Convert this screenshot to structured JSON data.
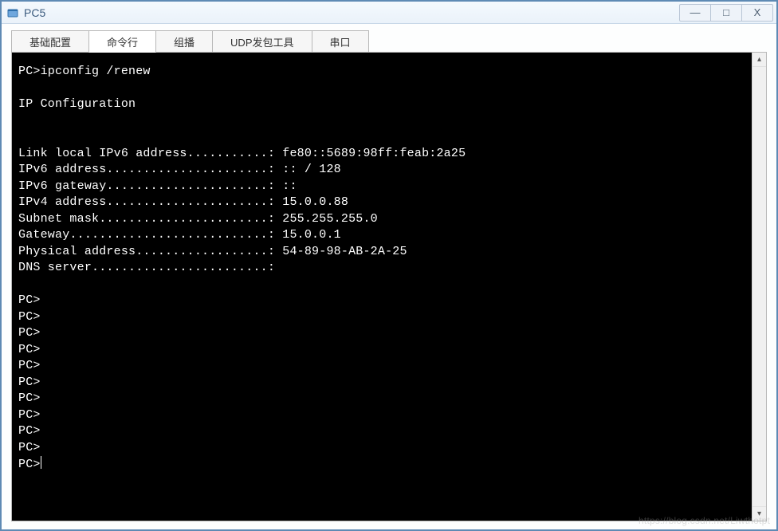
{
  "window": {
    "title": "PC5",
    "controls": {
      "minimize": "—",
      "maximize": "□",
      "close": "X"
    }
  },
  "tabs": [
    {
      "label": "基础配置",
      "active": false
    },
    {
      "label": "命令行",
      "active": true
    },
    {
      "label": "组播",
      "active": false
    },
    {
      "label": "UDP发包工具",
      "active": false
    },
    {
      "label": "串口",
      "active": false
    }
  ],
  "terminal": {
    "lines": [
      "PC>ipconfig /renew",
      "",
      "IP Configuration",
      "",
      "",
      "Link local IPv6 address...........: fe80::5689:98ff:feab:2a25",
      "IPv6 address......................: :: / 128",
      "IPv6 gateway......................: ::",
      "IPv4 address......................: 15.0.0.88",
      "Subnet mask.......................: 255.255.255.0",
      "Gateway...........................: 15.0.0.1",
      "Physical address..................: 54-89-98-AB-2A-25",
      "DNS server........................:",
      "",
      "PC>",
      "PC>",
      "PC>",
      "PC>",
      "PC>",
      "PC>",
      "PC>",
      "PC>",
      "PC>",
      "PC>",
      "PC>"
    ],
    "command": "ipconfig /renew",
    "ip_configuration": {
      "link_local_ipv6": "fe80::5689:98ff:feab:2a25",
      "ipv6_address": ":: / 128",
      "ipv6_gateway": "::",
      "ipv4_address": "15.0.0.88",
      "subnet_mask": "255.255.255.0",
      "gateway": "15.0.0.1",
      "physical_address": "54-89-98-AB-2A-25",
      "dns_server": ""
    }
  },
  "watermark": "https://blog.csdn.net/Liwthotpt"
}
